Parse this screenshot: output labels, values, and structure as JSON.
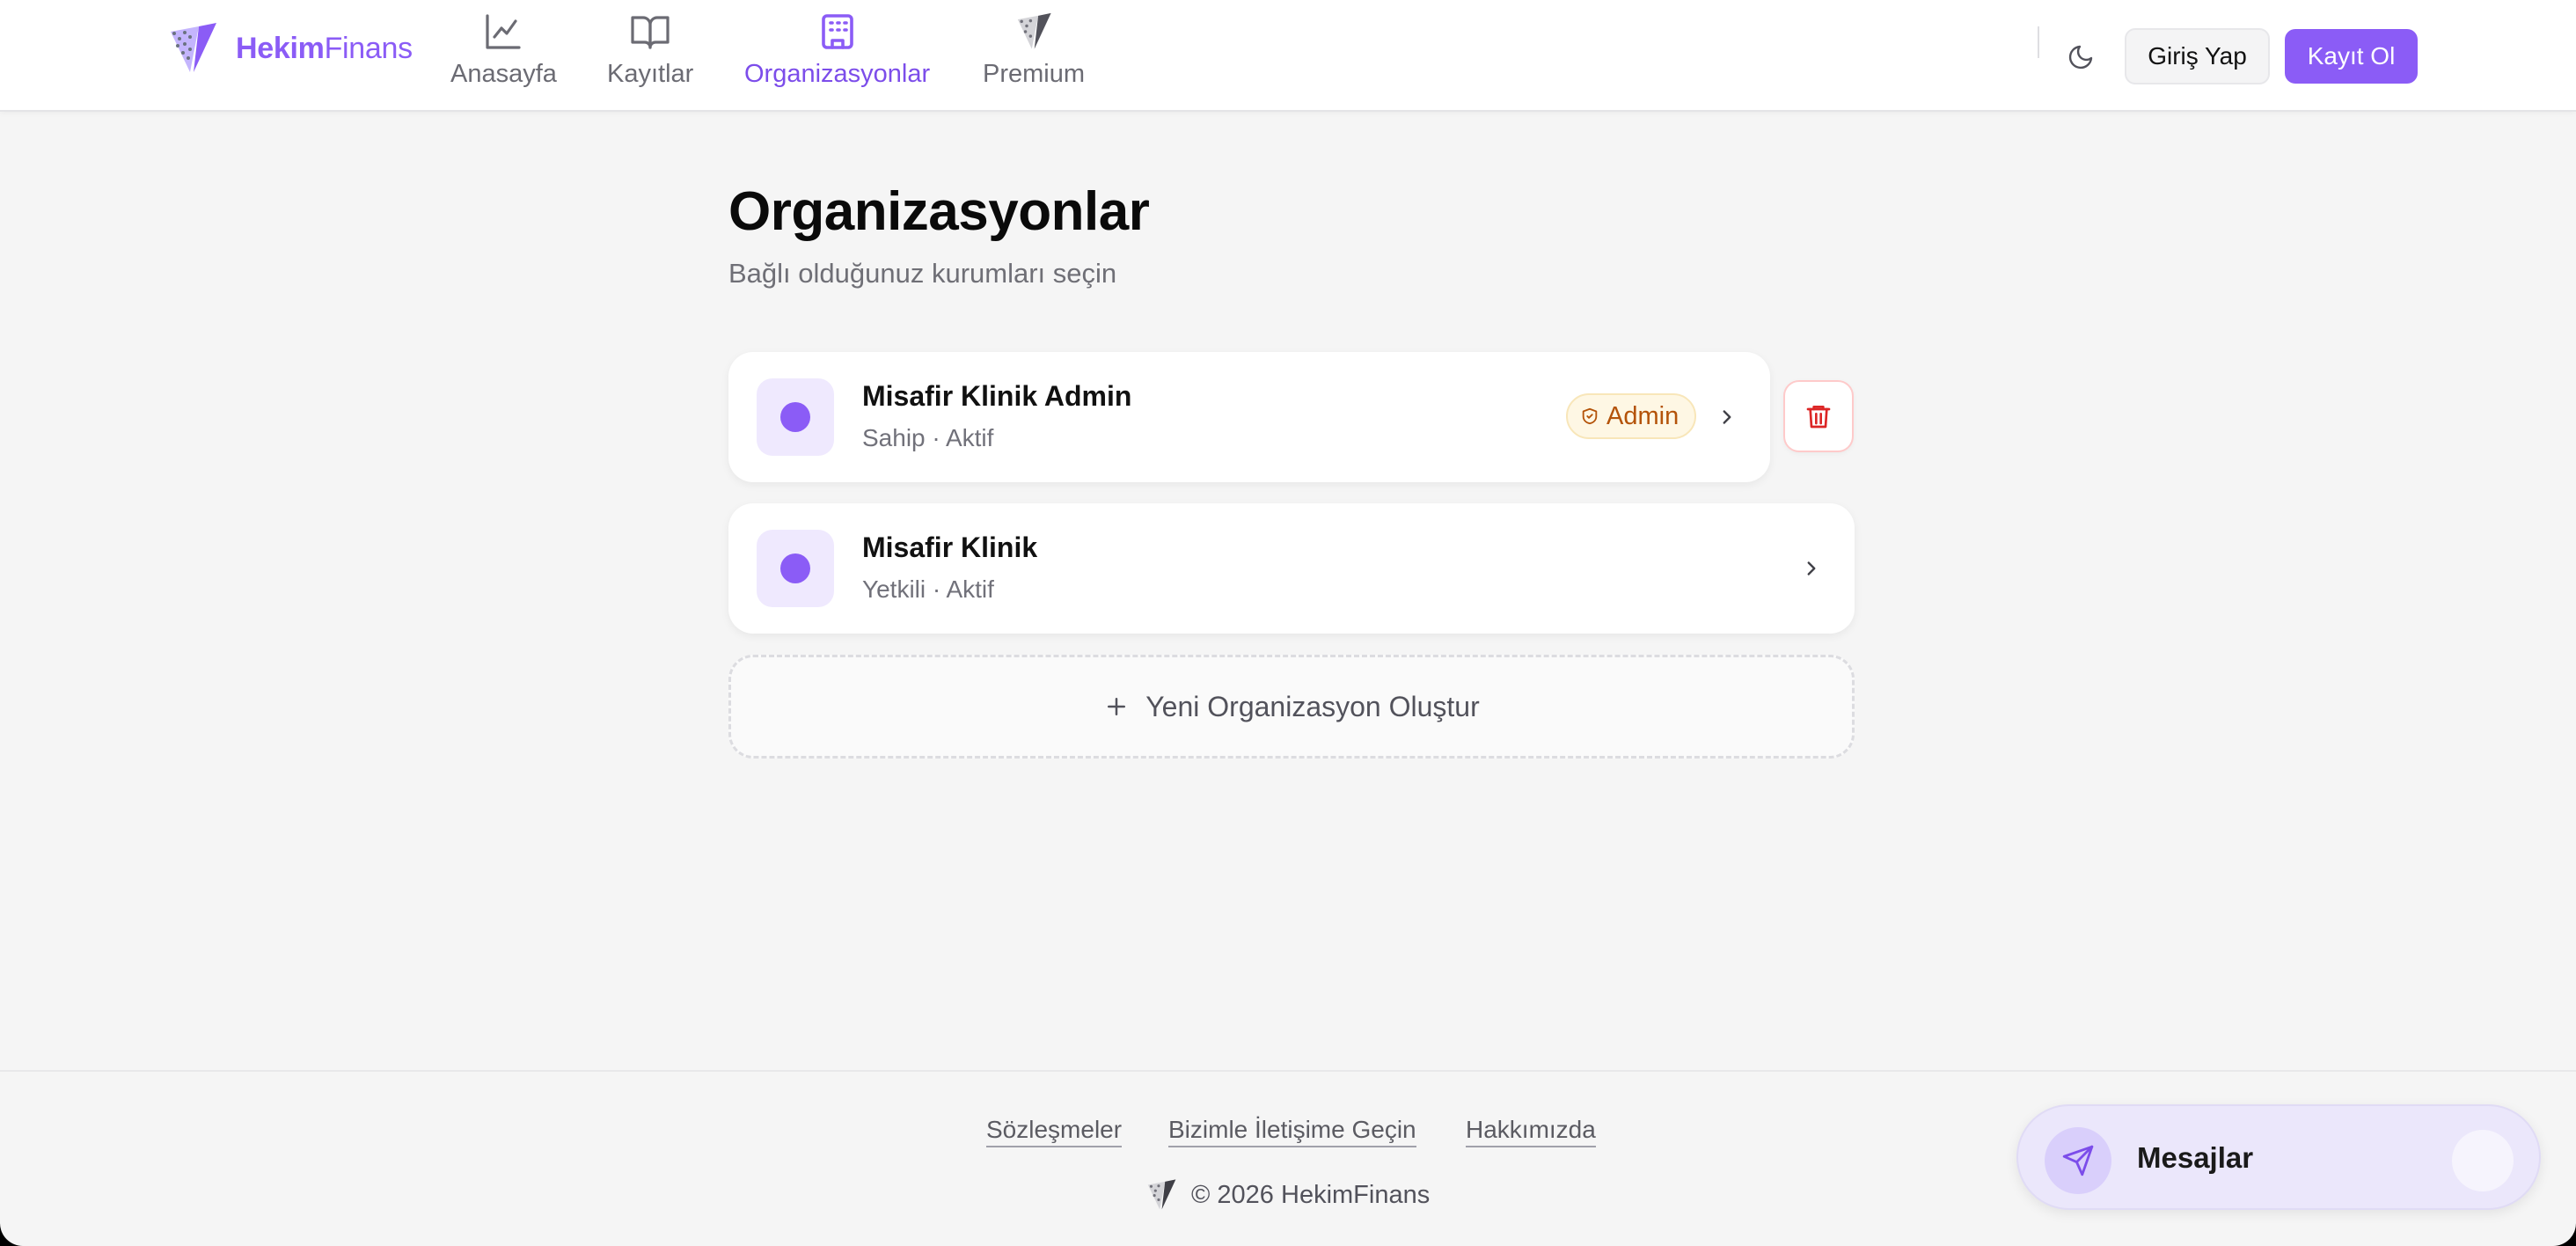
{
  "brand": {
    "name_bold": "Hekim",
    "name_regular": "Finans",
    "accent": "#8b5cf6"
  },
  "nav": [
    {
      "label": "Anasayfa",
      "icon": "chart-line-icon",
      "active": false
    },
    {
      "label": "Kayıtlar",
      "icon": "book-open-icon",
      "active": false
    },
    {
      "label": "Organizasyonlar",
      "icon": "building-icon",
      "active": true
    },
    {
      "label": "Premium",
      "icon": "logo-icon",
      "active": false
    }
  ],
  "header": {
    "login_label": "Giriş Yap",
    "register_label": "Kayıt Ol",
    "theme_icon": "moon-icon"
  },
  "main": {
    "title": "Organizasyonlar",
    "subtitle": "Bağlı olduğunuz kurumları seçin",
    "organizations": [
      {
        "name": "Misafir Klinik Admin",
        "meta": "Sahip · Aktif",
        "badge": "Admin",
        "deletable": true
      },
      {
        "name": "Misafir Klinik",
        "meta": "Yetkili · Aktif",
        "badge": null,
        "deletable": false
      }
    ],
    "new_org_label": "Yeni Organizasyon Oluştur"
  },
  "footer": {
    "links": [
      "Sözleşmeler",
      "Bizimle İletişime Geçin",
      "Hakkımızda"
    ],
    "copyright": "© 2026 HekimFinans"
  },
  "messages_widget": {
    "label": "Mesajlar",
    "icon": "send-icon"
  },
  "colors": {
    "badge_text": "#b45309",
    "danger": "#dc2626",
    "background": "#f5f5f5"
  }
}
